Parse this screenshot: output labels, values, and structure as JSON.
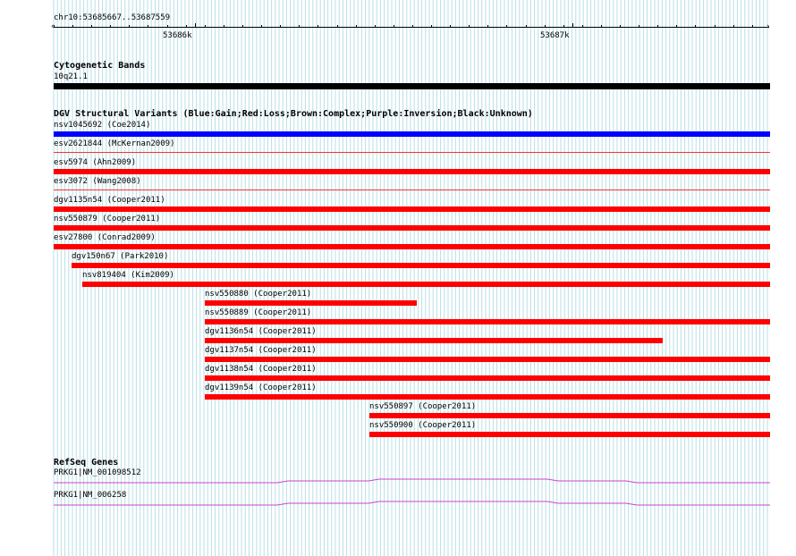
{
  "ruler": {
    "location": "chr10:53685667..53687559",
    "ticks": [
      "53686k",
      "53687k"
    ]
  },
  "cytoband": {
    "title": "Cytogenetic Bands",
    "band": "10q21.1",
    "color": "#000000"
  },
  "dgv": {
    "title": "DGV Structural Variants (Blue:Gain;Red:Loss;Brown:Complex;Purple:Inversion;Black:Unknown)",
    "colors": {
      "gain": "#0000ff",
      "loss": "#ff0000"
    },
    "variants": [
      {
        "label": "nsv1045692 (Coe2014)",
        "type": "gain"
      },
      {
        "label": "esv2621844 (McKernan2009)",
        "type": "loss"
      },
      {
        "label": "esv5974 (Ahn2009)",
        "type": "loss"
      },
      {
        "label": "esv3072 (Wang2008)",
        "type": "loss"
      },
      {
        "label": "dgv1135n54 (Cooper2011)",
        "type": "loss"
      },
      {
        "label": "nsv550879 (Cooper2011)",
        "type": "loss"
      },
      {
        "label": "esv27800 (Conrad2009)",
        "type": "loss"
      },
      {
        "label": "dgv150n67 (Park2010)",
        "type": "loss"
      },
      {
        "label": "nsv819404 (Kim2009)",
        "type": "loss"
      },
      {
        "label": "nsv550880 (Cooper2011)",
        "type": "loss"
      },
      {
        "label": "nsv550889 (Cooper2011)",
        "type": "loss"
      },
      {
        "label": "dgv1136n54 (Cooper2011)",
        "type": "loss"
      },
      {
        "label": "dgv1137n54 (Cooper2011)",
        "type": "loss"
      },
      {
        "label": "dgv1138n54 (Cooper2011)",
        "type": "loss"
      },
      {
        "label": "dgv1139n54 (Cooper2011)",
        "type": "loss"
      },
      {
        "label": "nsv550897 (Cooper2011)",
        "type": "loss"
      },
      {
        "label": "nsv550900 (Cooper2011)",
        "type": "loss"
      }
    ]
  },
  "refseq": {
    "title": "RefSeq Genes",
    "color": "#cc44cc",
    "genes": [
      {
        "label": "PRKG1|NM_001098512"
      },
      {
        "label": "PRKG1|NM_006258"
      }
    ]
  }
}
